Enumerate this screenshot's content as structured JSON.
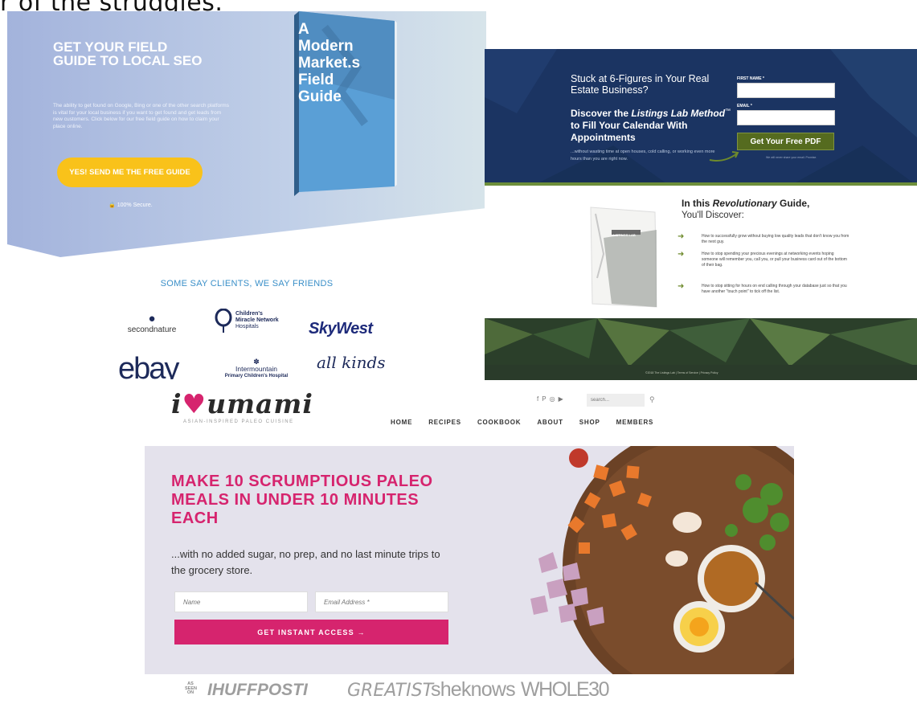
{
  "heading": "r of the struggles.",
  "panel1": {
    "headline": "GET YOUR FIELD GUIDE TO LOCAL SEO",
    "body": "The ability to get found on Google, Bing or one of the other search platforms is vital for your local business if you want to get found and get leads from new customers. Click below for our free field guide on how to claim your place online.",
    "cta": "YES! SEND ME THE FREE GUIDE",
    "secure": "100% Secure.",
    "book_title_lines": [
      "A",
      "Modern",
      "Market.s",
      "Field",
      "Guide"
    ],
    "clients_title": "SOME SAY CLIENTS, WE SAY FRIENDS",
    "logos": {
      "second_nature": "secondnature",
      "cmn_line1": "Children's",
      "cmn_line2": "Miracle Network",
      "cmn_line3": "Hospitals",
      "skywest": "SkyWest",
      "ebay": "ebay",
      "intermountain_line1": "Intermountain",
      "intermountain_line2": "Primary Children's Hospital",
      "allkinds": "all kinds"
    }
  },
  "panel2": {
    "stuck": "Stuck at 6-Figures in Your Real Estate Business?",
    "discover_prefix": "Discover the ",
    "discover_italic": "Listings Lab Method",
    "discover_tm": "™",
    "discover_suffix": " to Fill Your Calendar With Appointments",
    "sub": "...without wasting time at open houses, cold calling, or working even more hours than you are right now.",
    "first_name_label": "FIRST NAME *",
    "email_label": "EMAIL *",
    "button": "Get Your Free PDF",
    "privacy": "We will never share your email. Promise.",
    "guide_title_prefix": "In this ",
    "guide_title_italic": "Revolutionary",
    "guide_title_suffix": " Guide,",
    "guide_sub": "You'll Discover:",
    "book_label": "LISTINGS LAB",
    "bullets": [
      "How to successfully grow without buying low quality leads that don't know you from the next guy.",
      "How to stop spending your precious evenings at networking events hoping someone will remember you, call you, or pull your business card out of the bottom of their bag.",
      "How to stop sitting for hours on end calling through your database just so that you have another \"touch point\" to tick off the list."
    ],
    "footer": "©2018 The Listings Lab  |  Terms of Service  |  Privacy Policy"
  },
  "panel3": {
    "logo_i": "i",
    "logo_heart": "♥",
    "logo_word": "umami",
    "tagline": "ASIAN-INSPIRED PALEO CUISINE",
    "social": [
      "f",
      "P",
      "◎",
      "▶"
    ],
    "search_placeholder": "search...",
    "nav": [
      "HOME",
      "RECIPES",
      "COOKBOOK",
      "ABOUT",
      "SHOP",
      "MEMBERS"
    ],
    "headline": "MAKE 10 SCRUMPTIOUS PALEO MEALS IN UNDER 10 MINUTES EACH",
    "sub": "...with no added sugar, no prep, and no last minute trips to the grocery store.",
    "name_placeholder": "Name",
    "email_placeholder": "Email Address *",
    "cta": "GET INSTANT ACCESS →",
    "as_seen_on": "AS SEEN ON",
    "press": [
      "IHUFFPOSTI",
      "GREATIST",
      "sheknows",
      "WHOLE30"
    ]
  },
  "colors": {
    "p1_gradient_left": "#a3b3dc",
    "p1_gradient_right": "#d7e4ea",
    "p1_cta": "#f9c21a",
    "p2_navy": "#1b3462",
    "p2_green": "#556b1f",
    "p3_pink": "#d6246e",
    "p3_hero": "#e4e2ec"
  }
}
